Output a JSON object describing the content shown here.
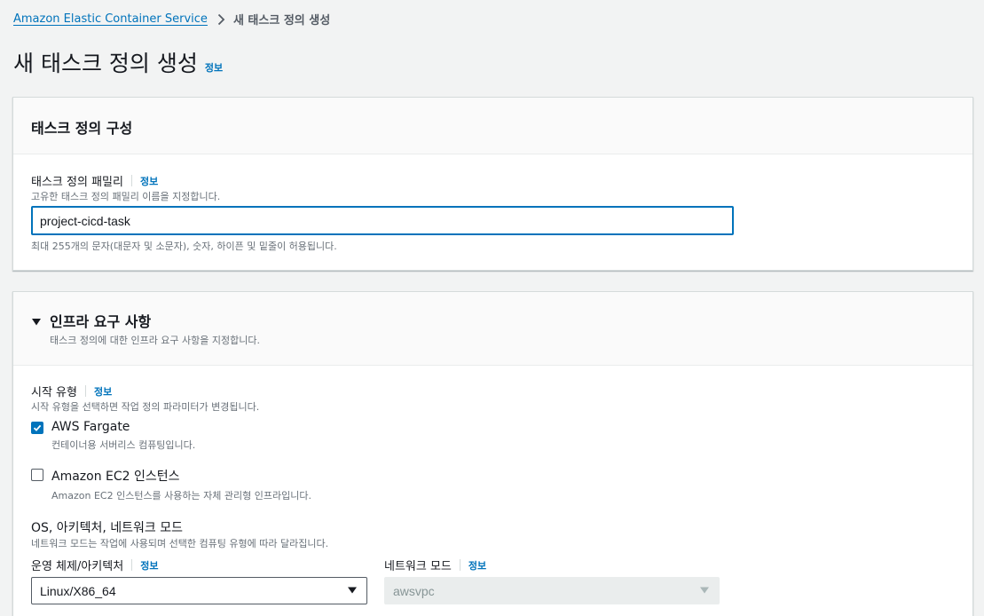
{
  "breadcrumb": {
    "service_link": "Amazon Elastic Container Service",
    "current": "새 태스크 정의 생성"
  },
  "page": {
    "title": "새 태스크 정의 생성",
    "info": "정보"
  },
  "task_def_config": {
    "title": "태스크 정의 구성",
    "family_label": "태스크 정의 패밀리",
    "family_info": "정보",
    "family_desc": "고유한 태스크 정의 패밀리 이름을 지정합니다.",
    "family_value": "project-cicd-task",
    "family_constraint": "최대 255개의 문자(대문자 및 소문자), 숫자, 하이픈 및 밑줄이 허용됩니다."
  },
  "infra": {
    "title": "인프라 요구 사항",
    "desc": "태스크 정의에 대한 인프라 요구 사항을 지정합니다.",
    "launch_type_label": "시작 유형",
    "launch_type_info": "정보",
    "launch_type_desc": "시작 유형을 선택하면 작업 정의 파라미터가 변경됩니다.",
    "options": [
      {
        "title": "AWS Fargate",
        "desc": "컨테이너용 서버리스 컴퓨팅입니다.",
        "checked": true
      },
      {
        "title": "Amazon EC2 인스턴스",
        "desc": "Amazon EC2 인스턴스를 사용하는 자체 관리형 인프라입니다.",
        "checked": false
      }
    ],
    "os_section_label": "OS, 아키텍처, 네트워크 모드",
    "os_section_desc": "네트워크 모드는 작업에 사용되며 선택한 컴퓨팅 유형에 따라 달라집니다.",
    "arch_label": "운영 체제/아키텍처",
    "arch_info": "정보",
    "arch_value": "Linux/X86_64",
    "network_label": "네트워크 모드",
    "network_info": "정보",
    "network_value": "awsvpc"
  },
  "colors": {
    "link": "#0073bb",
    "primary_text": "#16191f",
    "secondary_text": "#687078",
    "background": "#f2f3f3",
    "disabled_bg": "#eaeded"
  }
}
